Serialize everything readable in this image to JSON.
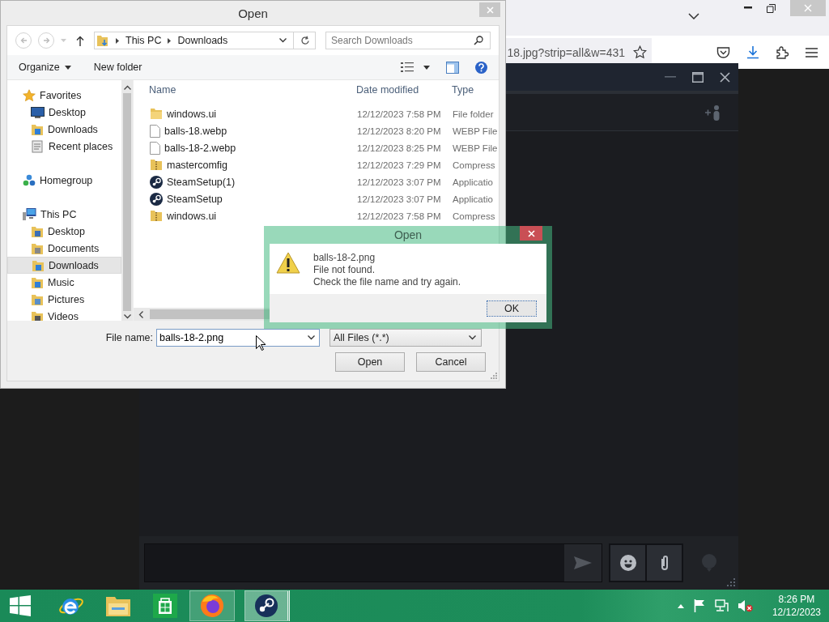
{
  "browser": {
    "url": "18.jpg?strip=all&w=431"
  },
  "open_dialog": {
    "title": "Open",
    "breadcrumb": [
      "This PC",
      "Downloads"
    ],
    "search": {
      "placeholder": "Search Downloads"
    },
    "toolbar": {
      "organize": "Organize",
      "new_folder": "New folder"
    },
    "nav": [
      {
        "label": "Favorites",
        "kind": "star",
        "selected": false,
        "children": [
          {
            "label": "Desktop",
            "kind": "desktop",
            "selected": false
          },
          {
            "label": "Downloads",
            "kind": "downloads",
            "selected": false
          },
          {
            "label": "Recent places",
            "kind": "recent",
            "selected": false
          }
        ]
      },
      {
        "label": "Homegroup",
        "kind": "homegroup",
        "selected": false
      },
      {
        "label": "This PC",
        "kind": "pc",
        "selected": false,
        "children": [
          {
            "label": "Desktop",
            "kind": "desktop-folder",
            "selected": false
          },
          {
            "label": "Documents",
            "kind": "documents",
            "selected": false
          },
          {
            "label": "Downloads",
            "kind": "downloads",
            "selected": true
          },
          {
            "label": "Music",
            "kind": "music",
            "selected": false
          },
          {
            "label": "Pictures",
            "kind": "pictures",
            "selected": false
          },
          {
            "label": "Videos",
            "kind": "videos",
            "selected": false
          }
        ]
      }
    ],
    "columns": [
      "Name",
      "Date modified",
      "Type"
    ],
    "files": [
      {
        "name": "windows.ui",
        "date": "12/12/2023 7:58 PM",
        "type": "File folder",
        "kind": "folder"
      },
      {
        "name": "balls-18.webp",
        "date": "12/12/2023 8:20 PM",
        "type": "WEBP File",
        "kind": "file"
      },
      {
        "name": "balls-18-2.webp",
        "date": "12/12/2023 8:25 PM",
        "type": "WEBP File",
        "kind": "file"
      },
      {
        "name": "mastercomfig",
        "date": "12/12/2023 7:29 PM",
        "type": "Compress",
        "kind": "zip"
      },
      {
        "name": "SteamSetup(1)",
        "date": "12/12/2023 3:07 PM",
        "type": "Applicatio",
        "kind": "app"
      },
      {
        "name": "SteamSetup",
        "date": "12/12/2023 3:07 PM",
        "type": "Applicatio",
        "kind": "app"
      },
      {
        "name": "windows.ui",
        "date": "12/12/2023 7:58 PM",
        "type": "Compress",
        "kind": "zip"
      }
    ],
    "file_name": {
      "label": "File name:",
      "value": "balls-18-2.png"
    },
    "file_type": "All Files (*.*)",
    "buttons": [
      "Open",
      "Cancel"
    ]
  },
  "message_box": {
    "title": "Open",
    "lines": [
      "balls-18-2.png",
      "File not found.",
      "Check the file name and try again."
    ],
    "button": "OK"
  },
  "taskbar": {
    "apps": [
      {
        "kind": "ie",
        "running": false,
        "selected": false
      },
      {
        "kind": "explorer",
        "running": false,
        "selected": false
      },
      {
        "kind": "store",
        "running": false,
        "selected": false
      },
      {
        "kind": "firefox",
        "running": true,
        "selected": false
      },
      {
        "kind": "steam",
        "running": true,
        "selected": true
      }
    ],
    "time": "8:26 PM",
    "date": "12/12/2023"
  }
}
